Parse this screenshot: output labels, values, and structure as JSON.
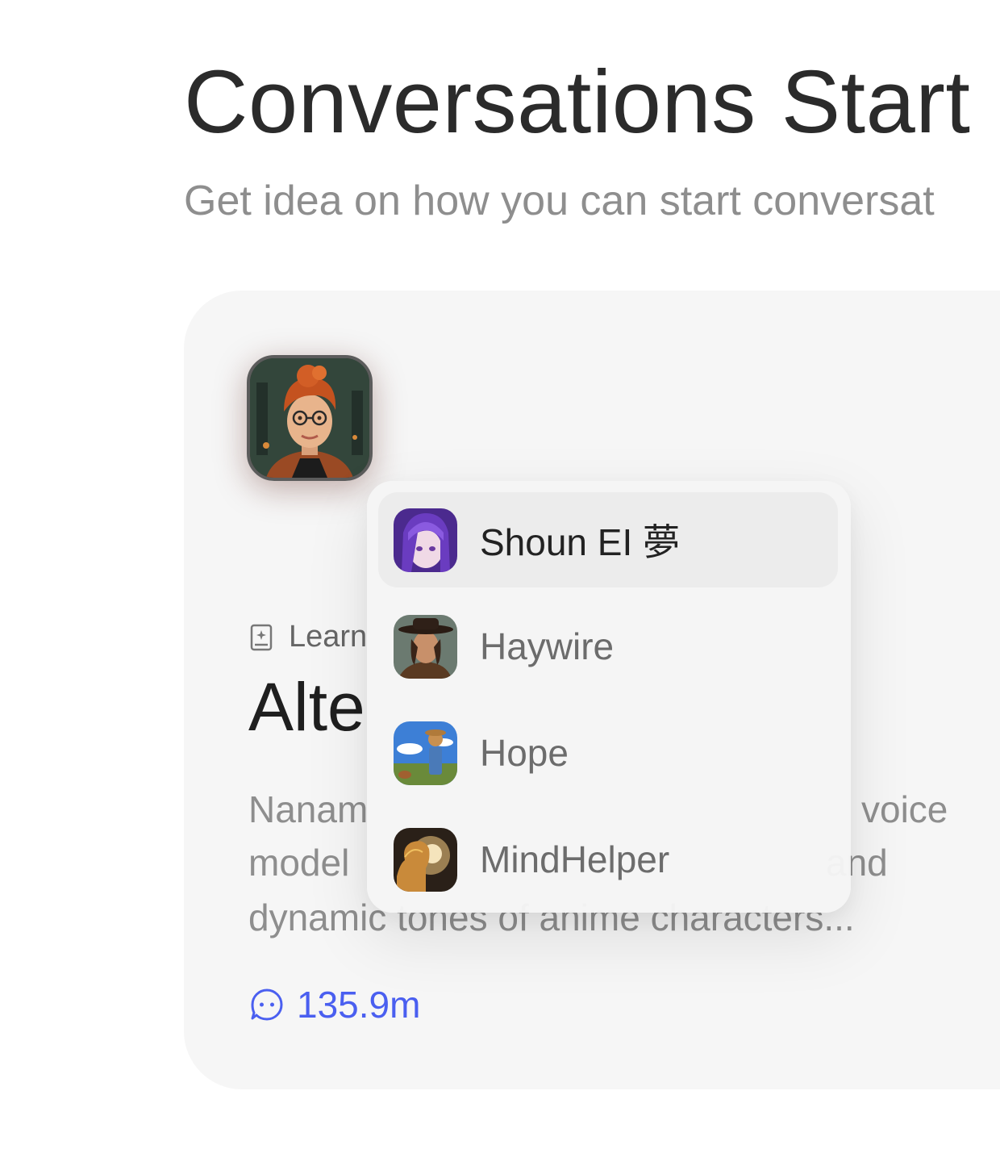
{
  "header": {
    "title": "Conversations Start",
    "subtitle": "Get idea on how you can start conversat"
  },
  "card": {
    "avatar_icon": "character-avatar-redhead-glasses",
    "category": {
      "icon": "learn-book-icon",
      "label": "Learn"
    },
    "title": "Alte",
    "description_fragments": {
      "line1_left": "Nanam",
      "line1_right": "voice",
      "line2_left": "model",
      "line2_right": "and",
      "line3": "dynamic tones of anime characters..."
    },
    "stats": {
      "icon": "chat-bubble-icon",
      "conversations": "135.9m"
    },
    "accent_color": "#4a5ff0"
  },
  "dropdown": {
    "items": [
      {
        "label": "Shoun EI 夢",
        "avatar_icon": "purple-hair-girl-avatar",
        "selected": true
      },
      {
        "label": "Haywire",
        "avatar_icon": "cowboy-hat-woman-avatar",
        "selected": false
      },
      {
        "label": "Hope",
        "avatar_icon": "scarecrow-robot-avatar",
        "selected": false
      },
      {
        "label": "MindHelper",
        "avatar_icon": "glowing-head-avatar",
        "selected": false
      }
    ]
  }
}
